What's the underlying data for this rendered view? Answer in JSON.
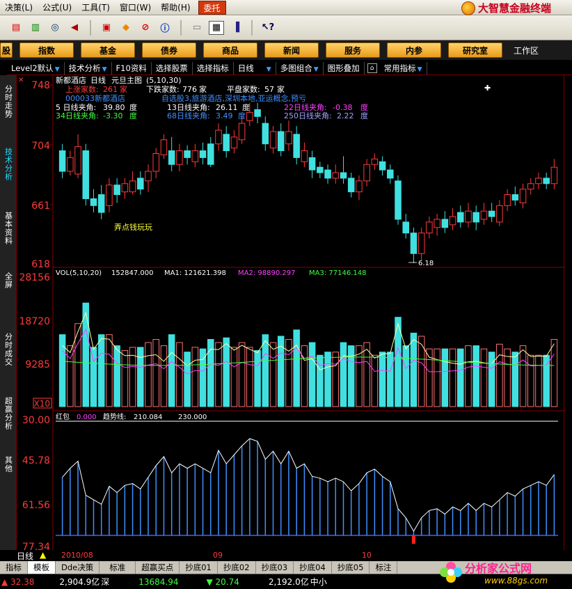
{
  "menu": {
    "items": [
      "决策(L)",
      "公式(U)",
      "工具(T)",
      "窗口(W)",
      "帮助(H)",
      "委托"
    ],
    "brand": "大智慧金融终端"
  },
  "toolbar": {
    "icons": [
      "quote-board-icon",
      "bar-chart-icon",
      "binoculars-icon",
      "megaphone-icon",
      "news-icon",
      "diamond-icon",
      "no-entry-icon",
      "info-icon",
      "print-icon",
      "layout-icon",
      "books-icon",
      "help-cursor-icon"
    ]
  },
  "nav": {
    "buttons": [
      "股",
      "指数",
      "基金",
      "债券",
      "商品",
      "新闻",
      "服务",
      "内参",
      "研究室"
    ],
    "extra": "工作区"
  },
  "subbar": {
    "items": [
      "Level2默认",
      "技术分析",
      "F10资料",
      "选择股票",
      "选择指标",
      "日线",
      "多图组合",
      "图形叠加",
      "常用指标"
    ]
  },
  "lefttabs": [
    "分时走势",
    "技术分析",
    "基本资料",
    "全屏",
    "分时成交",
    "超赢分析",
    "其他"
  ],
  "header": {
    "stock": "新都酒店",
    "period": "日线",
    "indicator": "元旦主图",
    "params": "(5,10,30)",
    "up_label": "上涨家数:",
    "up_value": "261",
    "up_unit": "家",
    "down_label": "下跌家数:",
    "down_value": "776",
    "down_unit": "家",
    "flat_label": "平盘家数:",
    "flat_value": "57",
    "flat_unit": "家",
    "code": "000033",
    "name": "新都酒店",
    "tags": "自选股3,旅游酒店,深圳本地,亚运概念,预亏",
    "angles": [
      {
        "text": "5 日线夹角:",
        "value": "39.80",
        "unit": "度",
        "color": "#ffffff"
      },
      {
        "text": "13日线夹角:",
        "value": "26.11",
        "unit": "度",
        "color": "#ffffff"
      },
      {
        "text": "22日线夹角:",
        "value": "-0.38",
        "unit": "度",
        "color": "#ff40ff"
      },
      {
        "text": "34日线夹角:",
        "value": "-3.30",
        "unit": "度",
        "color": "#40ff40"
      },
      {
        "text": "68日线夹角:",
        "value": "3.49",
        "unit": "度",
        "color": "#4090ff"
      },
      {
        "text": "250日线夹角:",
        "value": "2.22",
        "unit": "度",
        "color": "#a0a0ff"
      }
    ],
    "annotation": "弄点钱玩玩",
    "low_label": "6.18"
  },
  "price_axis": [
    "748",
    "704",
    "661",
    "618"
  ],
  "volume": {
    "title": "VOL(5,10,20)",
    "value": "152847.000",
    "ma1": "MA1: 121621.398",
    "ma2": "MA2: 98890.297",
    "ma3": "MA3: 77146.148",
    "axis": [
      "28156",
      "18720",
      "9285"
    ],
    "multiplier": "X10"
  },
  "hongbao": {
    "label": "红包",
    "value": "0.000",
    "trend_label": "趋势线:",
    "trend_value": "210.084",
    "extra_value": "230.000",
    "axis": [
      "30.00",
      "45.78",
      "61.56",
      "77.34"
    ]
  },
  "dateaxis": {
    "left": "日线",
    "dates": [
      "2010/08",
      "09",
      "10"
    ]
  },
  "bottomtabs": [
    "指标",
    "模板",
    "Dde决策",
    "标准",
    "超赢买点",
    "抄底01",
    "抄底02",
    "抄底03",
    "抄底04",
    "抄底05",
    "标注"
  ],
  "status": {
    "s1": "▲ 32.38",
    "s2": "2,904.9亿",
    "s2b": "深",
    "s3": "13684.94",
    "s4": "▼ 20.74",
    "s5": "2,192.0亿",
    "s5b": "中小"
  },
  "watermark": {
    "title": "分析家公式网",
    "url": "www.88gs.com"
  },
  "chart_data": {
    "type": "candlestick",
    "ylim": [
      618,
      748
    ],
    "candles": [
      {
        "o": 700,
        "c": 685,
        "h": 705,
        "l": 680
      },
      {
        "o": 685,
        "c": 695,
        "h": 700,
        "l": 682
      },
      {
        "o": 683,
        "c": 703,
        "h": 712,
        "l": 680
      },
      {
        "o": 700,
        "c": 665,
        "h": 705,
        "l": 660
      },
      {
        "o": 665,
        "c": 660,
        "h": 672,
        "l": 655
      },
      {
        "o": 668,
        "c": 655,
        "h": 675,
        "l": 650
      },
      {
        "o": 660,
        "c": 675,
        "h": 680,
        "l": 655
      },
      {
        "o": 675,
        "c": 668,
        "h": 680,
        "l": 662
      },
      {
        "o": 670,
        "c": 676,
        "h": 680,
        "l": 665
      },
      {
        "o": 670,
        "c": 678,
        "h": 685,
        "l": 668
      },
      {
        "o": 680,
        "c": 672,
        "h": 685,
        "l": 668
      },
      {
        "o": 678,
        "c": 685,
        "h": 690,
        "l": 670
      },
      {
        "o": 685,
        "c": 698,
        "h": 702,
        "l": 680
      },
      {
        "o": 697,
        "c": 708,
        "h": 712,
        "l": 694
      },
      {
        "o": 700,
        "c": 690,
        "h": 710,
        "l": 685
      },
      {
        "o": 690,
        "c": 700,
        "h": 705,
        "l": 685
      },
      {
        "o": 700,
        "c": 695,
        "h": 704,
        "l": 690
      },
      {
        "o": 692,
        "c": 700,
        "h": 705,
        "l": 688
      },
      {
        "o": 700,
        "c": 695,
        "h": 706,
        "l": 690
      },
      {
        "o": 705,
        "c": 690,
        "h": 710,
        "l": 688
      },
      {
        "o": 705,
        "c": 715,
        "h": 720,
        "l": 700
      },
      {
        "o": 712,
        "c": 700,
        "h": 718,
        "l": 695
      },
      {
        "o": 702,
        "c": 710,
        "h": 715,
        "l": 698
      },
      {
        "o": 708,
        "c": 720,
        "h": 725,
        "l": 705
      },
      {
        "o": 722,
        "c": 728,
        "h": 735,
        "l": 718
      },
      {
        "o": 730,
        "c": 725,
        "h": 735,
        "l": 720
      },
      {
        "o": 720,
        "c": 705,
        "h": 725,
        "l": 700
      },
      {
        "o": 702,
        "c": 714,
        "h": 718,
        "l": 698
      },
      {
        "o": 714,
        "c": 700,
        "h": 720,
        "l": 696
      },
      {
        "o": 705,
        "c": 714,
        "h": 722,
        "l": 700
      },
      {
        "o": 712,
        "c": 695,
        "h": 718,
        "l": 690
      },
      {
        "o": 692,
        "c": 700,
        "h": 706,
        "l": 688
      },
      {
        "o": 695,
        "c": 686,
        "h": 700,
        "l": 680
      },
      {
        "o": 688,
        "c": 684,
        "h": 692,
        "l": 680
      },
      {
        "o": 686,
        "c": 680,
        "h": 690,
        "l": 676
      },
      {
        "o": 680,
        "c": 684,
        "h": 690,
        "l": 676
      },
      {
        "o": 684,
        "c": 680,
        "h": 696,
        "l": 676
      },
      {
        "o": 680,
        "c": 670,
        "h": 684,
        "l": 666
      },
      {
        "o": 670,
        "c": 678,
        "h": 682,
        "l": 664
      },
      {
        "o": 678,
        "c": 690,
        "h": 694,
        "l": 674
      },
      {
        "o": 690,
        "c": 694,
        "h": 698,
        "l": 686
      },
      {
        "o": 692,
        "c": 686,
        "h": 696,
        "l": 682
      },
      {
        "o": 686,
        "c": 680,
        "h": 690,
        "l": 676
      },
      {
        "o": 678,
        "c": 650,
        "h": 682,
        "l": 646
      },
      {
        "o": 648,
        "c": 640,
        "h": 654,
        "l": 636
      },
      {
        "o": 640,
        "c": 625,
        "h": 644,
        "l": 618
      },
      {
        "o": 625,
        "c": 640,
        "h": 644,
        "l": 620
      },
      {
        "o": 640,
        "c": 648,
        "h": 652,
        "l": 636
      },
      {
        "o": 644,
        "c": 650,
        "h": 654,
        "l": 638
      },
      {
        "o": 650,
        "c": 644,
        "h": 656,
        "l": 640
      },
      {
        "o": 646,
        "c": 652,
        "h": 658,
        "l": 642
      },
      {
        "o": 655,
        "c": 648,
        "h": 660,
        "l": 644
      },
      {
        "o": 648,
        "c": 656,
        "h": 662,
        "l": 644
      },
      {
        "o": 655,
        "c": 648,
        "h": 660,
        "l": 642
      },
      {
        "o": 650,
        "c": 656,
        "h": 662,
        "l": 646
      },
      {
        "o": 656,
        "c": 652,
        "h": 662,
        "l": 648
      },
      {
        "o": 648,
        "c": 660,
        "h": 664,
        "l": 645
      },
      {
        "o": 660,
        "c": 668,
        "h": 672,
        "l": 656
      },
      {
        "o": 668,
        "c": 664,
        "h": 674,
        "l": 660
      },
      {
        "o": 662,
        "c": 672,
        "h": 676,
        "l": 658
      },
      {
        "o": 672,
        "c": 676,
        "h": 680,
        "l": 668
      },
      {
        "o": 676,
        "c": 680,
        "h": 684,
        "l": 672
      },
      {
        "o": 680,
        "c": 676,
        "h": 684,
        "l": 672
      },
      {
        "o": 676,
        "c": 688,
        "h": 694,
        "l": 672
      }
    ]
  }
}
